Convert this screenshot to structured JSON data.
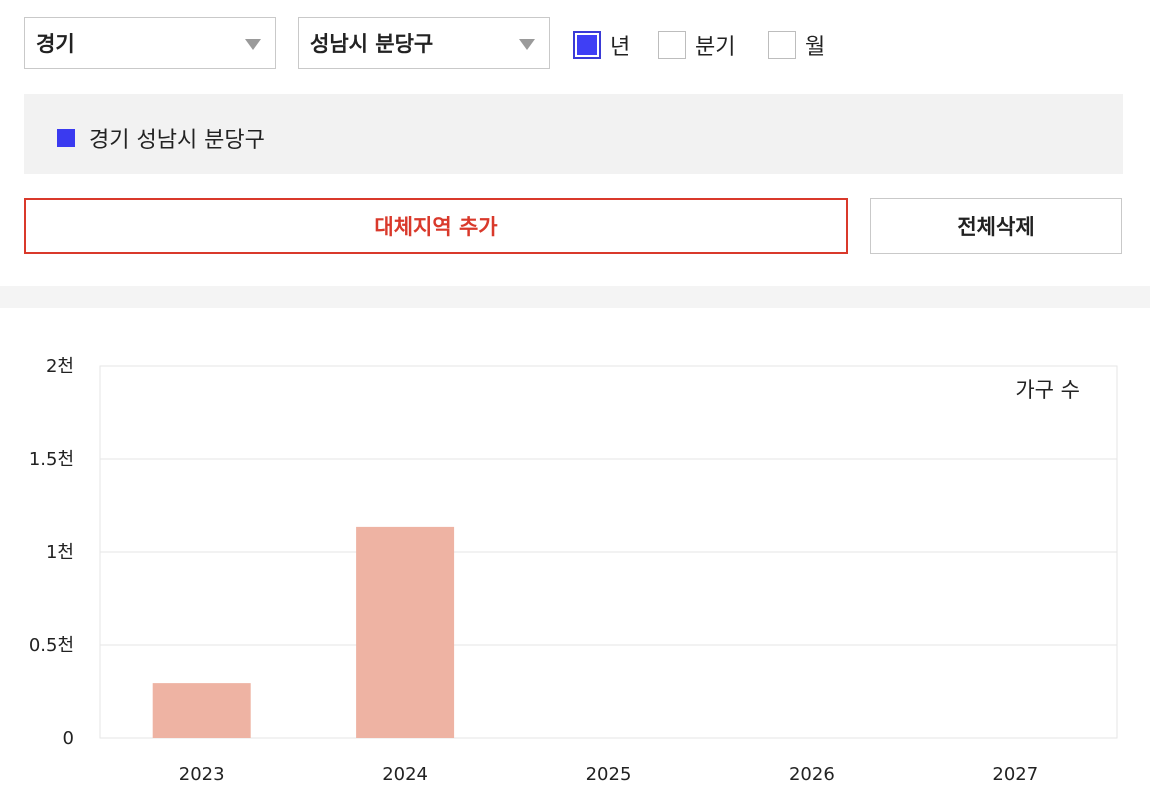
{
  "filters": {
    "province": "경기",
    "district": "성남시 분당구",
    "period_options": [
      {
        "label": "년",
        "checked": true
      },
      {
        "label": "분기",
        "checked": false
      },
      {
        "label": "월",
        "checked": false
      }
    ]
  },
  "selected_regions": [
    {
      "name": "경기 성남시 분당구",
      "color": "#3a3af0"
    }
  ],
  "buttons": {
    "add_region": "대체지역 추가",
    "delete_all": "전체삭제"
  },
  "colors": {
    "accent_red": "#d9392b",
    "bar_color": "#eeb3a3",
    "region_blue": "#3a3af0"
  },
  "chart_data": {
    "type": "bar",
    "title": "",
    "legend_text": "가구 수",
    "categories": [
      "2023",
      "2024",
      "2025",
      "2026",
      "2027"
    ],
    "values": [
      295,
      1135,
      null,
      null,
      null
    ],
    "ylim": [
      0,
      2000
    ],
    "yticks": [
      0,
      500,
      1000,
      1500,
      2000
    ],
    "ytick_labels": [
      "0",
      "0.5천",
      "1천",
      "1.5천",
      "2천"
    ],
    "grid": true
  }
}
